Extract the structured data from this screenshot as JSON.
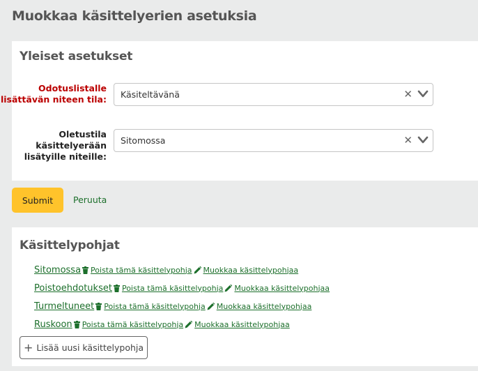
{
  "page": {
    "title": "Muokkaa käsittelyerien asetuksia"
  },
  "general": {
    "heading": "Yleiset asetukset",
    "waiting_label": "Odotuslistalle lisättävän niteen tila:",
    "waiting_value": "Käsiteltävänä",
    "default_label": "Oletustila käsittelyerään lisätyille niteille:",
    "default_value": "Sitomossa",
    "clear_glyph": "✕"
  },
  "actions": {
    "submit_label": "Submit",
    "cancel_label": "Peruuta"
  },
  "templates": {
    "heading": "Käsittelypohjat",
    "delete_label": "Poista tämä käsittelypohja",
    "edit_label": "Muokkaa käsittelypohjaa",
    "items": [
      {
        "name": "Sitomossa"
      },
      {
        "name": "Poistoehdotukset"
      },
      {
        "name": "Turmeltuneet"
      },
      {
        "name": "Ruskoon"
      }
    ],
    "add_label": "Lisää uusi käsittelypohja",
    "add_icon": "plus-icon"
  },
  "colors": {
    "accent": "#ffc32b",
    "link": "#1c6f2b",
    "required": "#bb0000",
    "background": "#eaebeb"
  }
}
